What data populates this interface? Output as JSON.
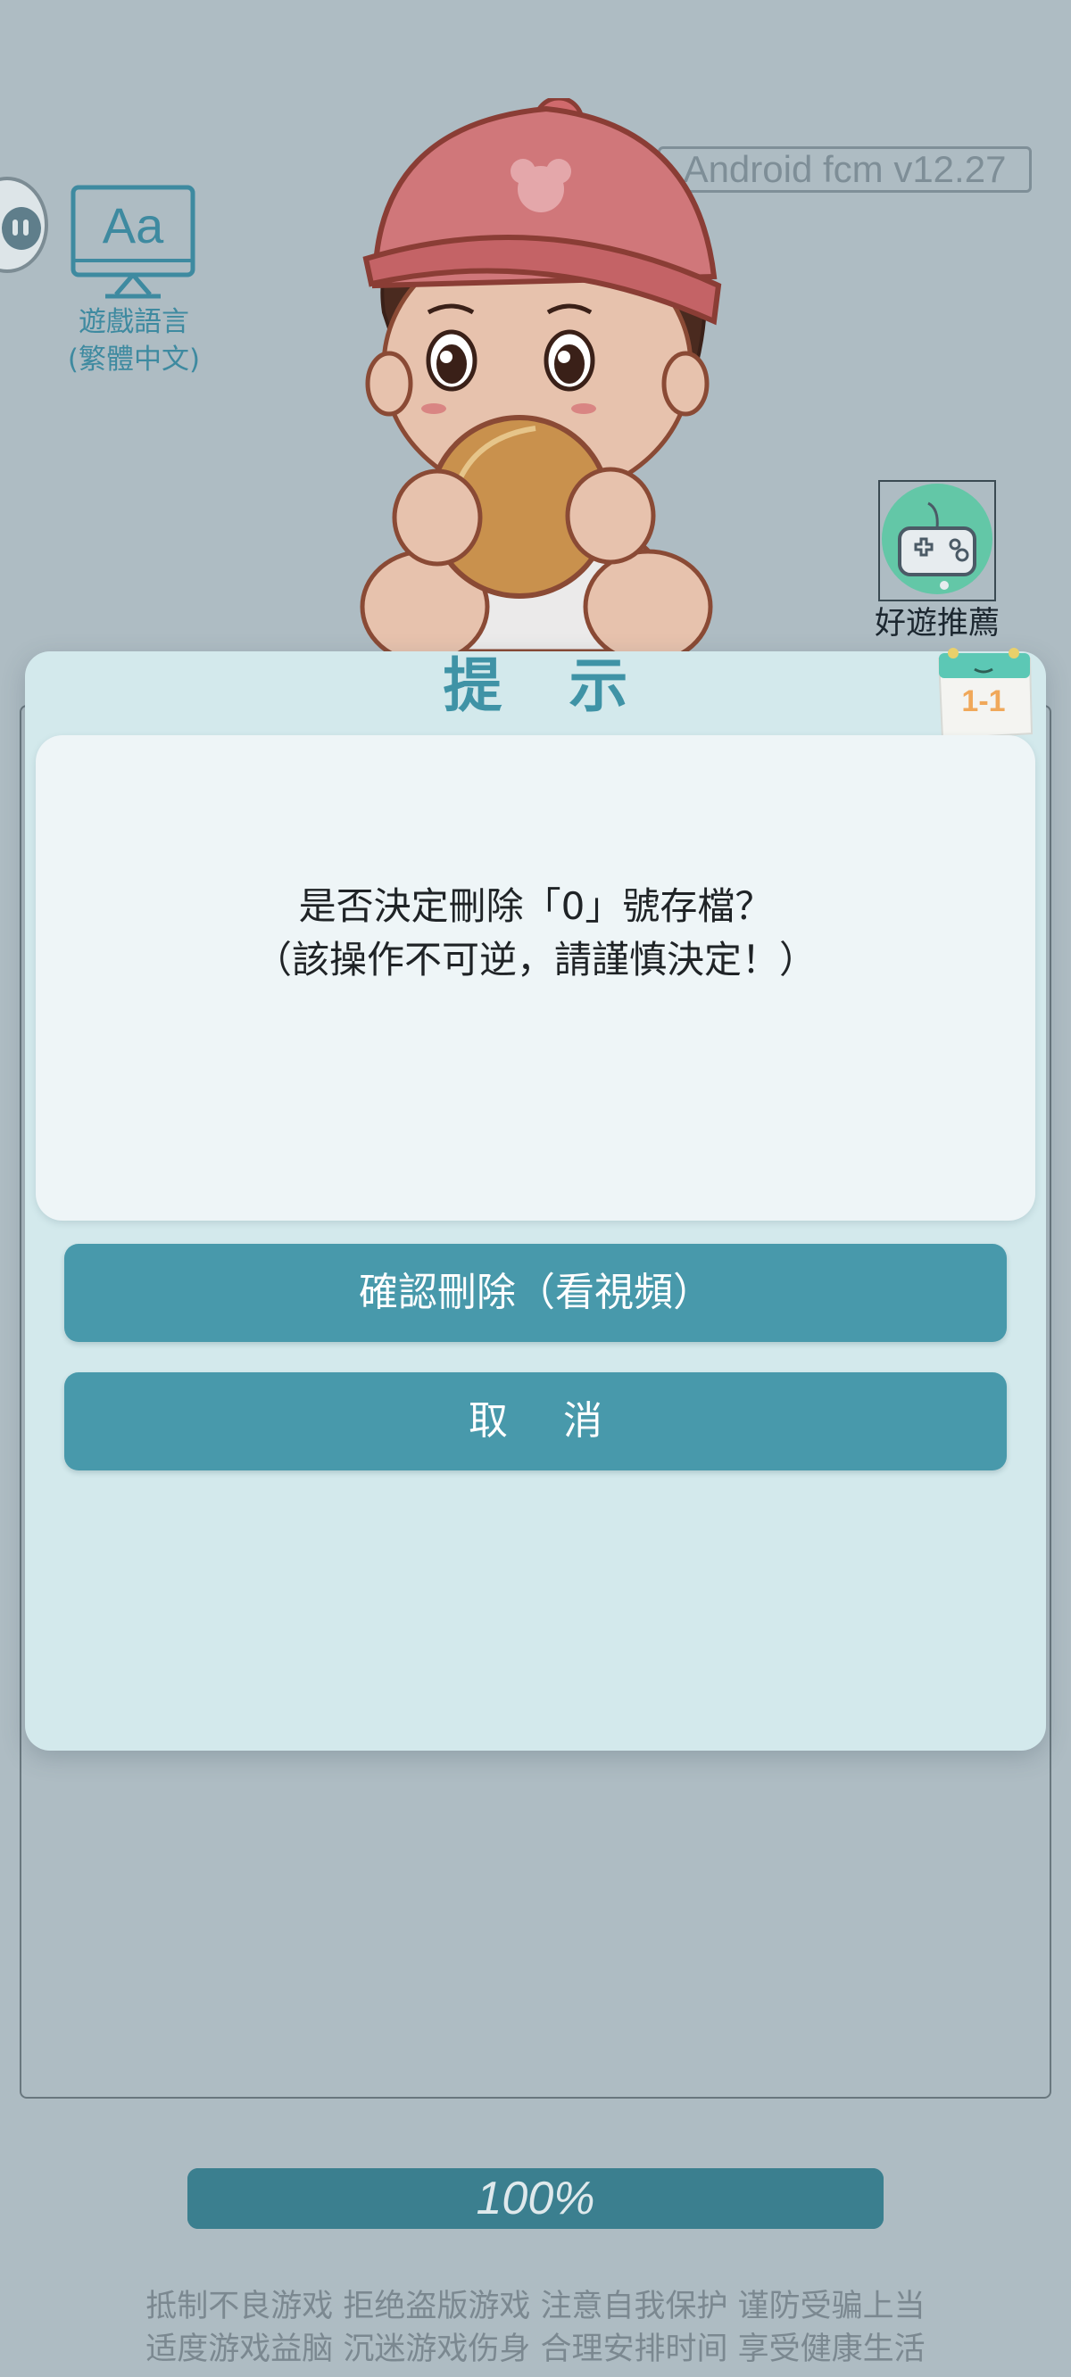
{
  "app": {
    "version": "Android fcm v12.27"
  },
  "language_widget": {
    "icon": "monitor-aa-icon",
    "icon_text": "Aa",
    "label_line1": "遊戲語言",
    "label_line2": "(繁體中文)"
  },
  "game_recommend": {
    "icon": "gamepad-icon",
    "label": "好遊推薦"
  },
  "dialog": {
    "title": "提 示",
    "level_badge": "1-1",
    "message_line1": "是否決定刪除「0」號存檔？",
    "message_line2": "（該操作不可逆，請謹慎決定！）",
    "confirm_label": "確認刪除（看視頻）",
    "cancel_label": "取 消"
  },
  "progress": {
    "value": 1.0,
    "text": "100%"
  },
  "footer": {
    "line1": "抵制不良游戏 拒绝盗版游戏 注意自我保护 谨防受骗上当",
    "line2": "适度游戏益脑 沉迷游戏伤身 合理安排时间 享受健康生活"
  },
  "colors": {
    "background": "#aebcc3",
    "accent": "#4899ab",
    "dialog_bg": "#d3e9ec",
    "title": "#3f93a6"
  }
}
